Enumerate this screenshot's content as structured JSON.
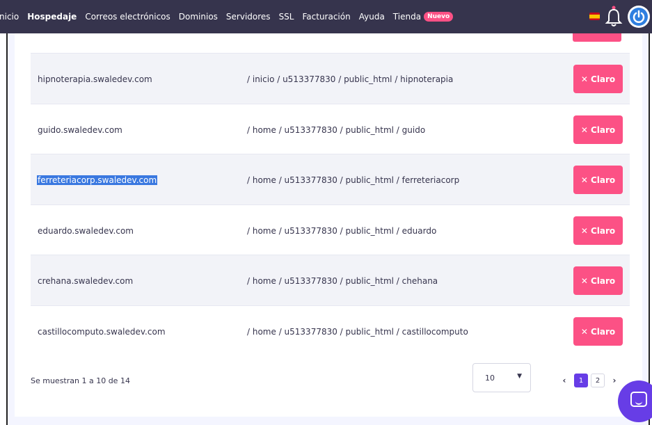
{
  "nav": {
    "items": [
      "nicio",
      "Hospedaje",
      "Correos electrónicos",
      "Dominios",
      "Servidores",
      "SSL",
      "Facturación",
      "Ayuda",
      "Tienda"
    ],
    "active_index": 1,
    "badge": "Nuevo"
  },
  "rows": [
    {
      "domain": "hipnoterapia.swaledev.com",
      "path": "/ inicio / u513377830 / public_html / hipnoterapia",
      "action": "Claro"
    },
    {
      "domain": "guido.swaledev.com",
      "path": "/ home / u513377830 / public_html / guido",
      "action": "Claro"
    },
    {
      "domain": "ferreteriacorp.swaledev.com",
      "path": "/ home / u513377830 / public_html / ferreteriacorp",
      "action": "Claro",
      "selected": true
    },
    {
      "domain": "eduardo.swaledev.com",
      "path": "/ home / u513377830 / public_html / eduardo",
      "action": "Claro"
    },
    {
      "domain": "crehana.swaledev.com",
      "path": "/ home / u513377830 / public_html / chehana",
      "action": "Claro"
    },
    {
      "domain": "castillocomputo.swaledev.com",
      "path": "/ home / u513377830 / public_html / castillocomputo",
      "action": "Claro"
    }
  ],
  "footer": {
    "showing": "Se muestran 1 a 10 de 14",
    "page_size": "10",
    "pages": [
      "1",
      "2"
    ],
    "current_page": "1"
  },
  "colors": {
    "nav_bg": "#36344d",
    "accent_pink": "#fc5185",
    "accent_purple": "#673de6",
    "selection": "#3a78e0"
  },
  "icons": {
    "flag": "spain-flag-icon",
    "bell": "bell-icon",
    "power": "power-icon",
    "close": "x-icon",
    "chat": "chat-icon"
  }
}
